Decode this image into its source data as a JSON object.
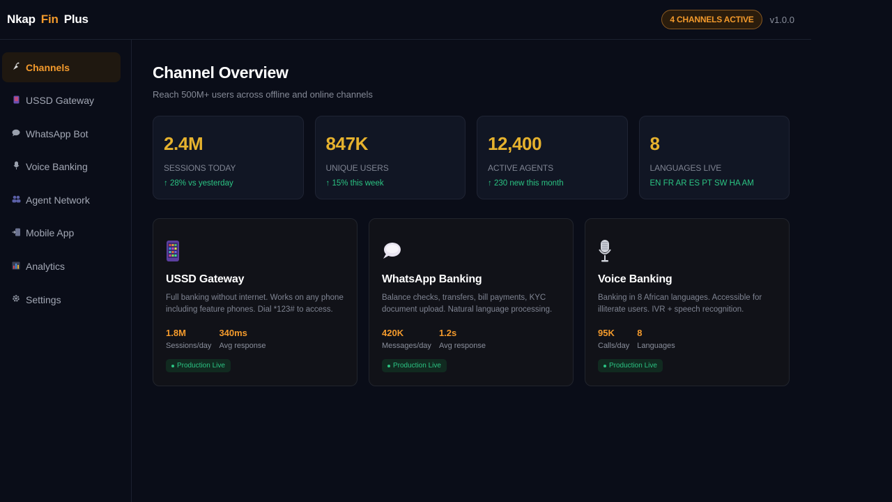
{
  "header": {
    "brand": [
      "Nkap",
      "Fin",
      "Plus"
    ],
    "active_badge": "4 CHANNELS ACTIVE",
    "version": "v1.0.0"
  },
  "sidebar": {
    "items": [
      {
        "label": "Channels",
        "icon": "satellite-icon",
        "active": true
      },
      {
        "label": "USSD Gateway",
        "icon": "phone-icon",
        "active": false
      },
      {
        "label": "WhatsApp Bot",
        "icon": "chat-bubble-icon",
        "active": false
      },
      {
        "label": "Voice Banking",
        "icon": "microphone-icon",
        "active": false
      },
      {
        "label": "Agent Network",
        "icon": "people-icon",
        "active": false
      },
      {
        "label": "Mobile App",
        "icon": "mobile-arrow-icon",
        "active": false
      },
      {
        "label": "Analytics",
        "icon": "bar-chart-icon",
        "active": false
      },
      {
        "label": "Settings",
        "icon": "gear-icon",
        "active": false
      }
    ]
  },
  "main": {
    "title": "Channel Overview",
    "subtitle": "Reach 500M+ users across offline and online channels",
    "stats": [
      {
        "value": "2.4M",
        "label": "Sessions Today",
        "sub": "↑ 28% vs yesterday"
      },
      {
        "value": "847K",
        "label": "Unique Users",
        "sub": "↑ 15% this week"
      },
      {
        "value": "12,400",
        "label": "Active Agents",
        "sub": "↑ 230 new this month"
      },
      {
        "value": "8",
        "label": "Languages Live",
        "sub": "EN FR AR ES PT SW HA AM"
      }
    ],
    "cards": [
      {
        "icon": "phone-icon",
        "title": "USSD Gateway",
        "desc": "Full banking without internet. Works on any phone including feature phones. Dial *123# to access.",
        "m1_value": "1.8M",
        "m1_label": "Sessions/day",
        "m2_value": "340ms",
        "m2_label": "Avg response",
        "status": "Production Live"
      },
      {
        "icon": "chat-bubble-icon",
        "title": "WhatsApp Banking",
        "desc": "Balance checks, transfers, bill payments, KYC document upload. Natural language processing.",
        "m1_value": "420K",
        "m1_label": "Messages/day",
        "m2_value": "1.2s",
        "m2_label": "Avg response",
        "status": "Production Live"
      },
      {
        "icon": "microphone-icon",
        "title": "Voice Banking",
        "desc": "Banking in 8 African languages. Accessible for illiterate users. IVR + speech recognition.",
        "m1_value": "95K",
        "m1_label": "Calls/day",
        "m2_value": "8",
        "m2_label": "Languages",
        "status": "Production Live"
      }
    ]
  },
  "colors": {
    "accent": "#f39a2c",
    "stat_value": "#e6b22e",
    "positive": "#2bc483",
    "background": "#0a0d18"
  }
}
